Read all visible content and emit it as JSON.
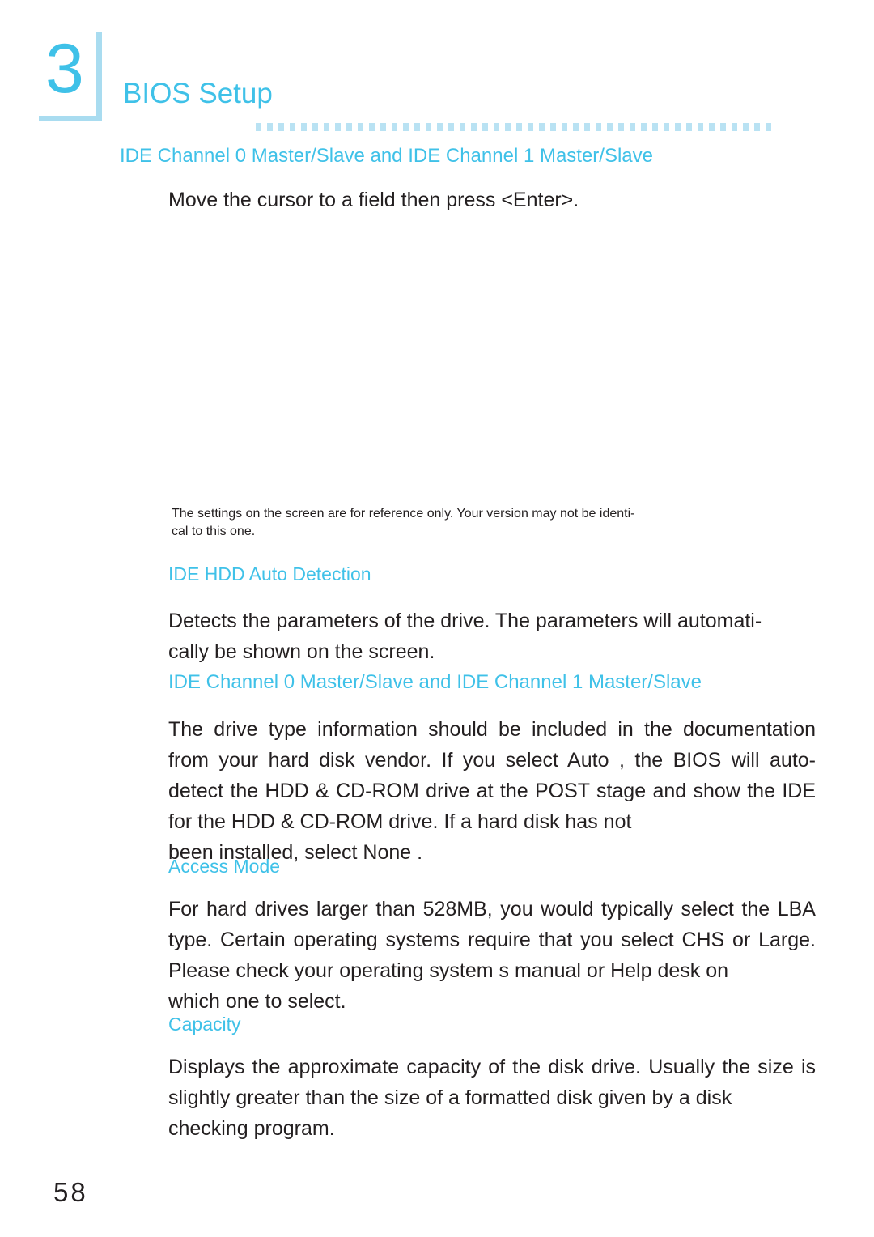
{
  "page": {
    "number": "58",
    "chapter_number": "3",
    "chapter_title": "BIOS Setup"
  },
  "sections": [
    {
      "id": "ide-channel-top",
      "heading": "IDE Channel 0 Master/Slave and IDE Channel 1 Master/Slave",
      "body": "Move the cursor to a field then press <Enter>."
    },
    {
      "id": "ide-hdd-auto-detection",
      "heading": "IDE HDD Auto Detection",
      "body_line1": "Detects the parameters of the drive. The parameters will automati-",
      "body_line2": "cally be shown on the screen."
    },
    {
      "id": "ide-channel-mid",
      "heading": "IDE Channel 0 Master/Slave and IDE Channel 1 Master/Slave",
      "body_line1": "The drive type information should be included in the documentation",
      "body_line2": "from your hard disk vendor. If you select  Auto , the BIOS will auto-",
      "body_line3": "detect the HDD & CD-ROM drive at the POST stage and show",
      "body_line4": "the IDE for the HDD & CD-ROM drive. If a hard disk has not",
      "body_line5": "been installed, select  None ."
    },
    {
      "id": "access-mode",
      "heading": "Access Mode",
      "body_line1": "For hard drives larger than 528MB, you would typically select the",
      "body_line2": "LBA type. Certain operating systems require that you select CHS or",
      "body_line3": "Large. Please check your operating system s manual or Help desk on",
      "body_line4": "which one to select."
    },
    {
      "id": "capacity",
      "heading": "Capacity",
      "body_line1": "Displays the approximate capacity of the disk drive. Usually the size",
      "body_line2": "is slightly greater than the size of a formatted disk given by a disk",
      "body_line3": "checking program."
    }
  ],
  "note": {
    "line1": "The settings on the screen are for reference only. Your version may not be identi-",
    "line2": "cal to this one."
  },
  "colors": {
    "accent": "#3fc1e8",
    "accent_light": "#a9dcf0",
    "dots": "#b9e2f3",
    "text": "#231f20"
  }
}
